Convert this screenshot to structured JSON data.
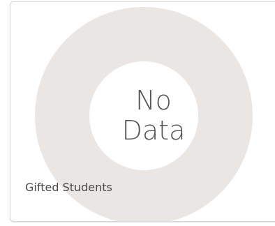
{
  "chart_data": {
    "type": "pie",
    "categories": [],
    "values": [],
    "empty_state": [
      "No",
      "Data"
    ],
    "label": "Gifted Students",
    "ring_color": "#eae6e4"
  }
}
